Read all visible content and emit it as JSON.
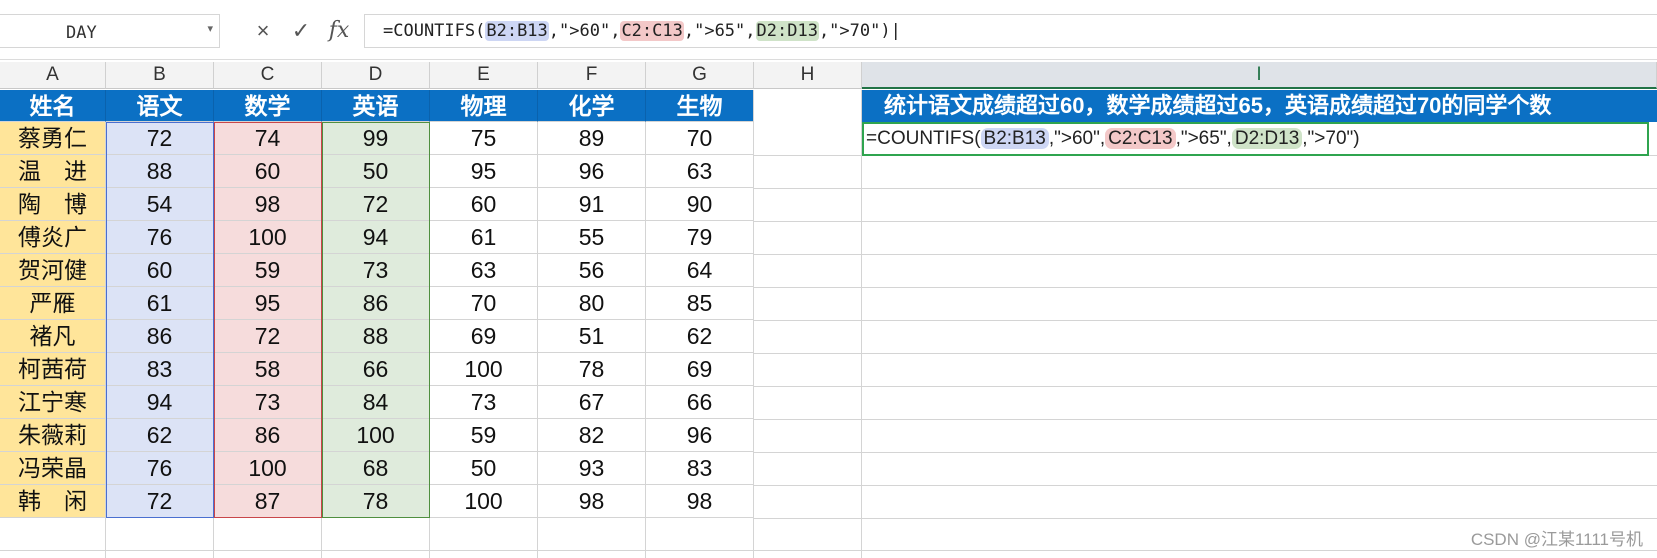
{
  "formula_bar": {
    "name_box": "DAY",
    "cancel_icon": "×",
    "enter_icon": "✓",
    "fx_label": "fx",
    "formula_parts": [
      "=COUNTIFS(",
      "B2:B13",
      ",\">60\",",
      "C2:C13",
      ",\">65\",",
      "D2:D13",
      ",\">70\")"
    ]
  },
  "columns": [
    "A",
    "B",
    "C",
    "D",
    "E",
    "F",
    "G",
    "H",
    "I"
  ],
  "headers": [
    "姓名",
    "语文",
    "数学",
    "英语",
    "物理",
    "化学",
    "生物"
  ],
  "rows": [
    [
      "蔡勇仁",
      "72",
      "74",
      "99",
      "75",
      "89",
      "70"
    ],
    [
      "温　进",
      "88",
      "60",
      "50",
      "95",
      "96",
      "63"
    ],
    [
      "陶　博",
      "54",
      "98",
      "72",
      "60",
      "91",
      "90"
    ],
    [
      "傅炎广",
      "76",
      "100",
      "94",
      "61",
      "55",
      "79"
    ],
    [
      "贺河健",
      "60",
      "59",
      "73",
      "63",
      "56",
      "64"
    ],
    [
      "严雁",
      "61",
      "95",
      "86",
      "70",
      "80",
      "85"
    ],
    [
      "褚凡",
      "86",
      "72",
      "88",
      "69",
      "51",
      "62"
    ],
    [
      "柯茜荷",
      "83",
      "58",
      "66",
      "100",
      "78",
      "69"
    ],
    [
      "江宁寒",
      "94",
      "73",
      "84",
      "73",
      "67",
      "66"
    ],
    [
      "朱薇莉",
      "62",
      "86",
      "100",
      "59",
      "82",
      "96"
    ],
    [
      "冯荣晶",
      "76",
      "100",
      "68",
      "50",
      "93",
      "83"
    ],
    [
      "韩　闲",
      "72",
      "87",
      "78",
      "100",
      "98",
      "98"
    ]
  ],
  "title_cell": "统计语文成绩超过60，数学成绩超过65，英语成绩超过70的同学个数",
  "edit_cell_parts": [
    "=COUNTIFS(",
    "B2:B13",
    ",\">60\",",
    "C2:C13",
    ",\">65\",",
    "D2:D13",
    ",\">70\")"
  ],
  "watermark": "CSDN @江某1111号机",
  "colors": {
    "header_blue": "#0b70c4",
    "name_yellow": "#ffe59a",
    "range_b": "#dce3f6",
    "range_c": "#f6dcdc",
    "range_d": "#dfebdc",
    "active_green": "#2fa44f"
  }
}
